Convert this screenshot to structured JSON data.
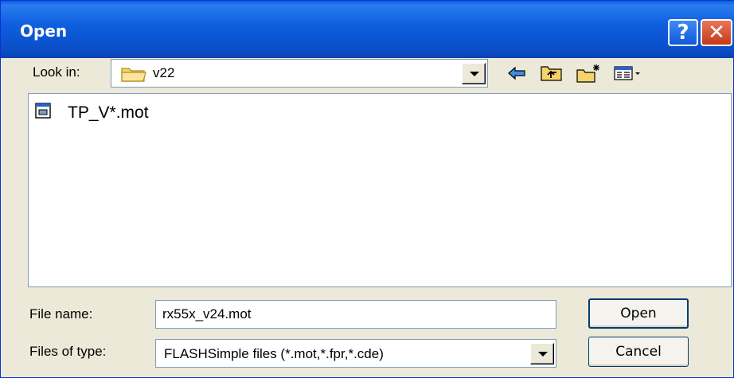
{
  "window": {
    "title": "Open",
    "help_label": "?",
    "close_label": "✕"
  },
  "toolbar": {
    "look_in_label": "Look in:",
    "look_in_value": "v22",
    "icons": [
      "folder-icon",
      "back-arrow-icon",
      "up-folder-icon",
      "new-folder-icon",
      "view-menu-icon"
    ]
  },
  "file_list": {
    "items": [
      {
        "name": "TP_V*.mot",
        "icon": "mot-file-icon"
      }
    ]
  },
  "form": {
    "file_name_label": "File name:",
    "file_name_value": "rx55x_v24.mot",
    "file_type_label": "Files of type:",
    "file_type_value": "FLASHSimple files (*.mot,*.fpr,*.cde)"
  },
  "buttons": {
    "open_label": "Open",
    "cancel_label": "Cancel"
  },
  "colors": {
    "titlebar": "#0a4ec8",
    "dialog_bg": "#ece9d8",
    "close": "#c5391a"
  }
}
